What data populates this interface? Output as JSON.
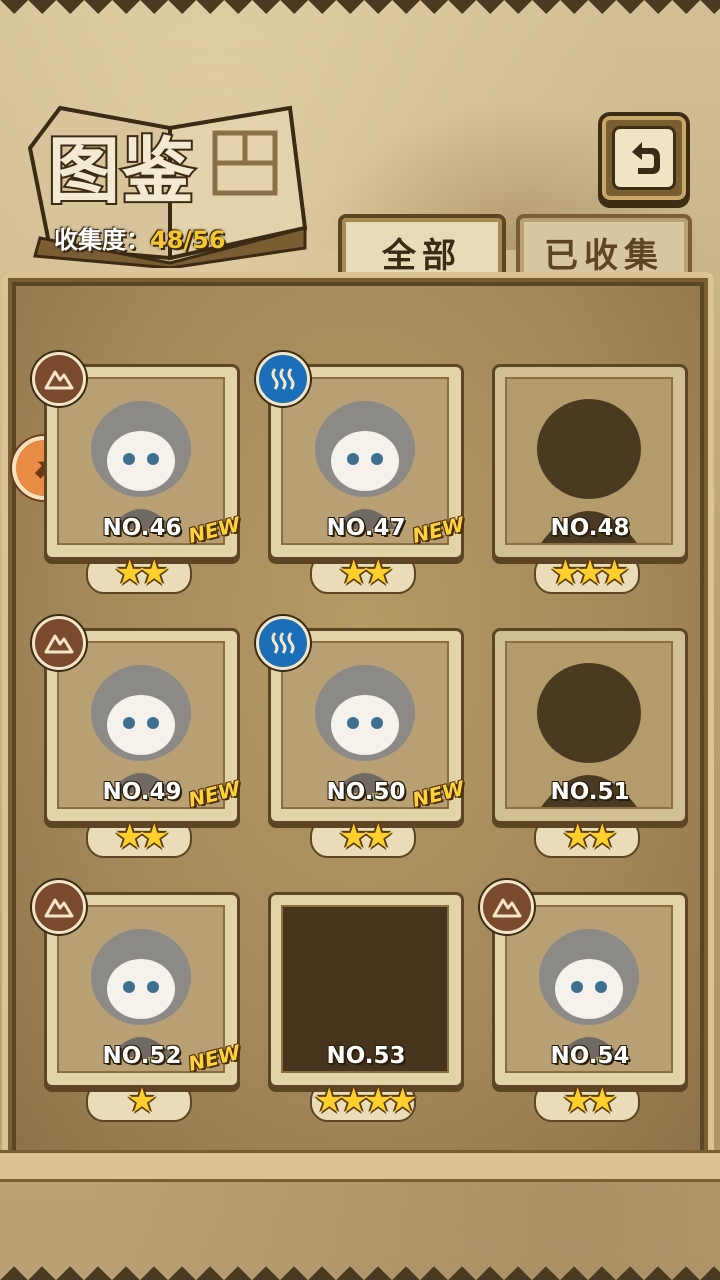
{
  "header": {
    "title": "图鉴",
    "collection_label": "收集度：",
    "collection_value": "48/56"
  },
  "tabs": [
    {
      "label": "全部",
      "active": true
    },
    {
      "label": "已收集",
      "active": false
    }
  ],
  "icons": {
    "back": "back-arrow-icon",
    "earth": "earth-attribute-icon",
    "water": "water-attribute-icon",
    "side": "side-pointer-icon"
  },
  "new_label": "NEW",
  "colors": {
    "star": "#ffcf2e",
    "earth_badge": "#7a4a2c",
    "water_badge": "#1a6fb8",
    "new_tag": "#ffd23a"
  },
  "cards": [
    {
      "number": "NO.46",
      "stars": "★★",
      "attribute": "earth",
      "is_new": true,
      "state": "owned"
    },
    {
      "number": "NO.47",
      "stars": "★★",
      "attribute": "water",
      "is_new": true,
      "state": "owned"
    },
    {
      "number": "NO.48",
      "stars": "★★★",
      "attribute": "",
      "is_new": false,
      "state": "silhouette"
    },
    {
      "number": "NO.49",
      "stars": "★★",
      "attribute": "earth",
      "is_new": true,
      "state": "owned"
    },
    {
      "number": "NO.50",
      "stars": "★★",
      "attribute": "water",
      "is_new": true,
      "state": "owned"
    },
    {
      "number": "NO.51",
      "stars": "★★",
      "attribute": "",
      "is_new": false,
      "state": "silhouette"
    },
    {
      "number": "NO.52",
      "stars": "★",
      "attribute": "earth",
      "is_new": true,
      "state": "owned"
    },
    {
      "number": "NO.53",
      "stars": "★★★★",
      "attribute": "",
      "is_new": false,
      "state": "unknown"
    },
    {
      "number": "NO.54",
      "stars": "★★",
      "attribute": "earth",
      "is_new": false,
      "state": "owned"
    }
  ]
}
